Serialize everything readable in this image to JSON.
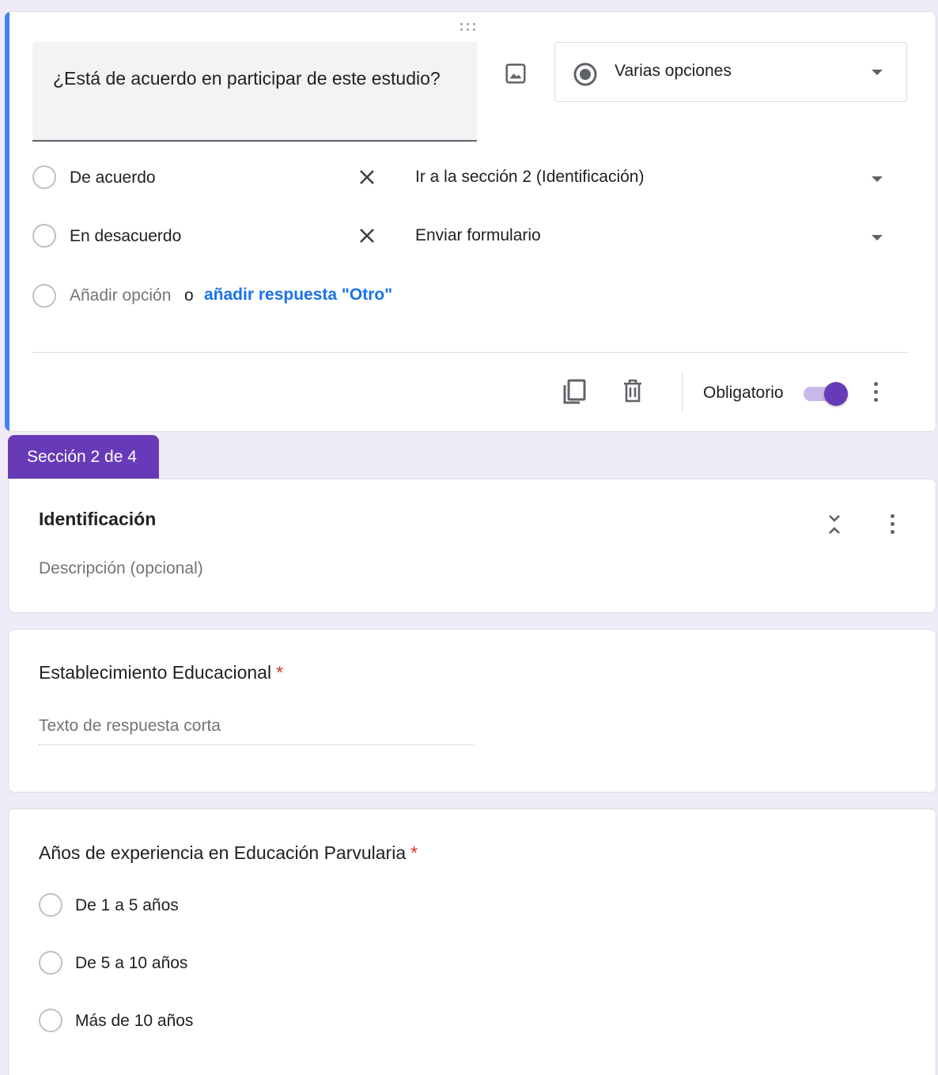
{
  "question1": {
    "title": "¿Está de acuerdo en participar de este estudio?",
    "type_label": "Varias opciones",
    "options": [
      {
        "label": "De acuerdo",
        "goto": "Ir a la sección 2 (Identificación)"
      },
      {
        "label": "En desacuerdo",
        "goto": "Enviar formulario"
      }
    ],
    "add_option": "Añadir opción",
    "or": "o",
    "add_other": "añadir respuesta \"Otro\"",
    "required_label": "Obligatorio",
    "required": true
  },
  "section": {
    "tab_label": "Sección 2 de 4",
    "title": "Identificación",
    "description_placeholder": "Descripción (opcional)"
  },
  "question2": {
    "title": "Establecimiento Educacional",
    "required_mark": "*",
    "answer_placeholder": "Texto de respuesta corta"
  },
  "question3": {
    "title": "Años de experiencia en Educación Parvularia",
    "required_mark": "*",
    "options": [
      "De 1 a 5 años",
      "De 5 a 10 años",
      "Más de 10 años"
    ]
  },
  "colors": {
    "accent": "#673ab7",
    "active_border": "#4285f4",
    "link": "#1a73e8",
    "required": "#d93025",
    "background": "#f0ebf8"
  },
  "icons": {
    "drag": "drag-handle-icon",
    "image": "image-icon",
    "type": "radio-button-checked-icon",
    "remove": "close-icon",
    "copy": "copy-icon",
    "delete": "trash-icon",
    "more": "more-vert-icon",
    "collapse": "unfold-less-icon"
  }
}
